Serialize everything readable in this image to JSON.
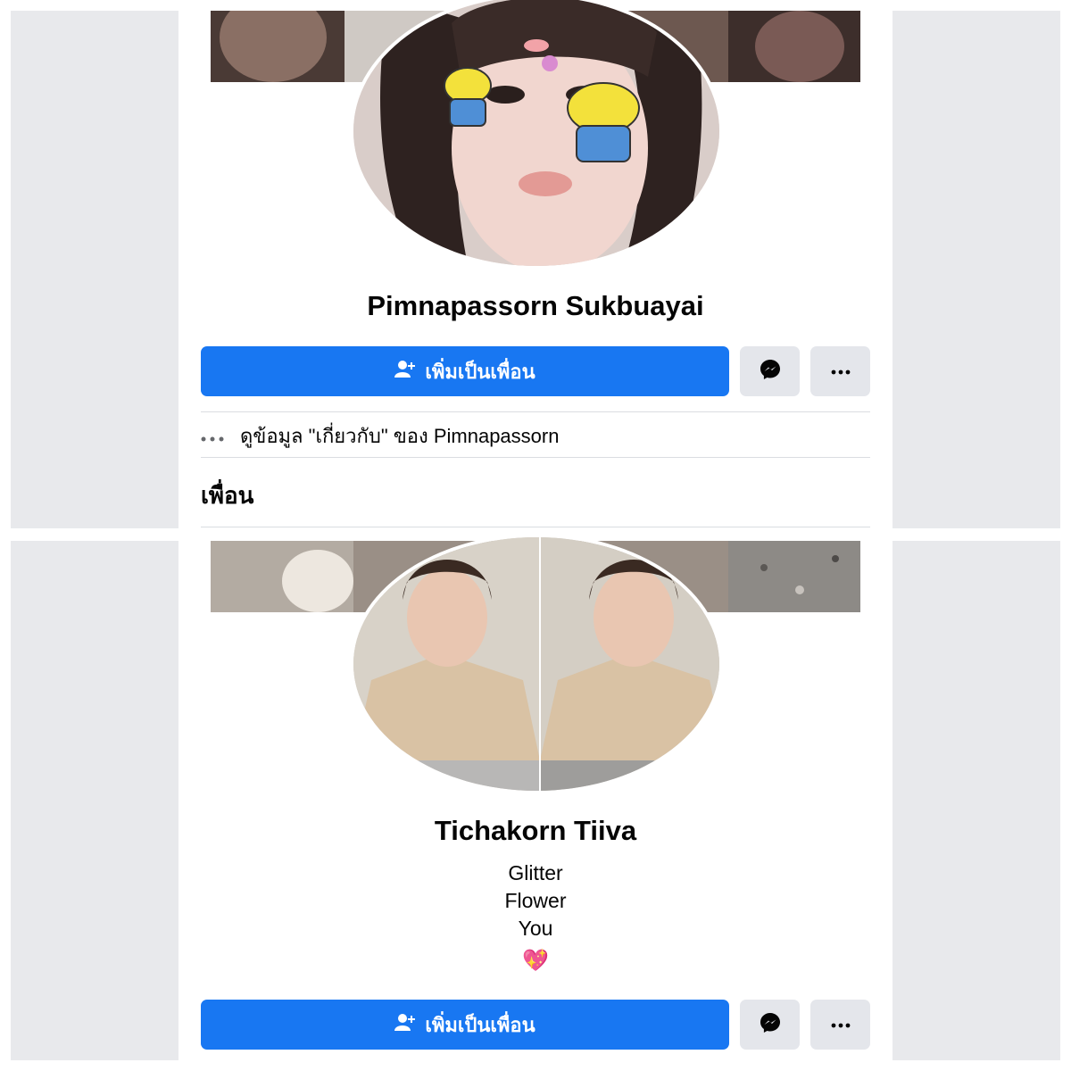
{
  "profiles": [
    {
      "name": "Pimnapassorn Sukbuayai",
      "add_friend_label": "เพิ่มเป็นเพื่อน",
      "about_link": "ดูข้อมูล \"เกี่ยวกับ\" ของ Pimnapassorn",
      "section_title": "เพื่อน"
    },
    {
      "name": "Tichakorn Tiiva",
      "bio": [
        "Glitter",
        "Flower",
        "You",
        "💖"
      ],
      "add_friend_label": "เพิ่มเป็นเพื่อน"
    }
  ],
  "icons": {
    "add_friend": "person-plus-icon",
    "messenger": "messenger-icon",
    "more": "more-horizontal-icon",
    "about_more": "ellipsis-icon"
  },
  "colors": {
    "primary": "#1877f2",
    "secondary_button": "#e4e6eb",
    "side_background": "#e8e9ec",
    "divider": "#dadde1"
  }
}
